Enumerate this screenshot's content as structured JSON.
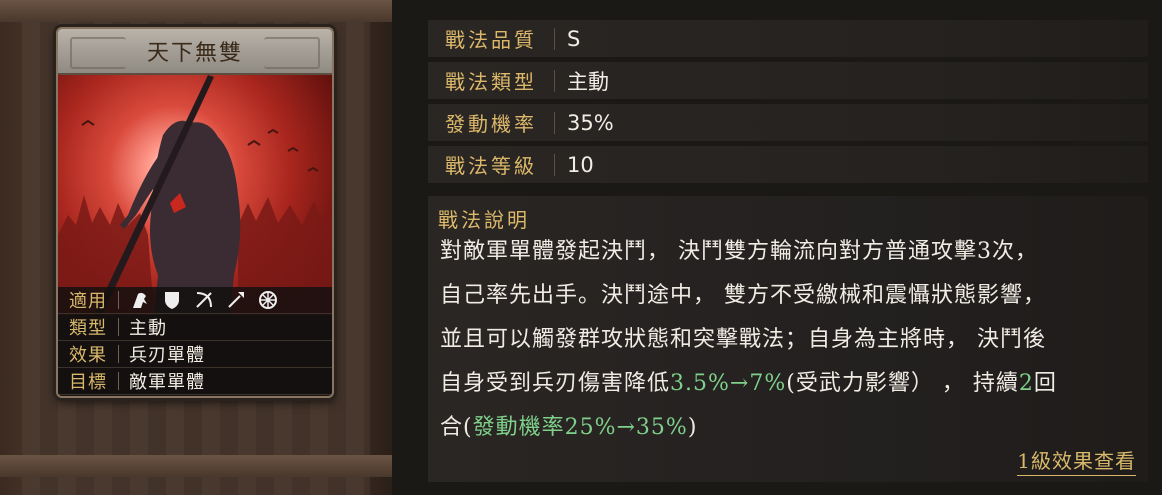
{
  "card": {
    "title": "天下無雙",
    "attributes": [
      {
        "label": "適用",
        "value": "",
        "icons": [
          "cavalry-icon",
          "shield-icon",
          "bow-icon",
          "spear-icon",
          "wheel-icon"
        ]
      },
      {
        "label": "類型",
        "value": "主動"
      },
      {
        "label": "效果",
        "value": "兵刃單體"
      },
      {
        "label": "目標",
        "value": "敵軍單體"
      }
    ]
  },
  "details": {
    "quality_label": "戰法品質",
    "quality_value": "S",
    "type_label": "戰法類型",
    "type_value": "主動",
    "rate_label": "發動機率",
    "rate_value": "35%",
    "level_label": "戰法等級",
    "level_value": "10"
  },
  "description": {
    "title": "戰法說明",
    "line1": "對敵軍單體發起決鬥， 決鬥雙方輪流向對方普通攻擊3次，",
    "line2": "自己率先出手。決鬥途中， 雙方不受繳械和震懾狀態影響，",
    "line3": "並且可以觸發群攻狀態和突擊戰法；自身為主將時， 決鬥後",
    "line4_a": "自身受到兵刃傷害降低",
    "line4_b": "3.5%→7%",
    "line4_c": "(受武力影響） ， 持續",
    "line4_d": "2",
    "line4_e": "回",
    "line5_a": "合(",
    "line5_b": "發動機率25%→35%",
    "line5_c": ")"
  },
  "link": {
    "more": "1級效果查看"
  },
  "colors": {
    "gold": "#dcb86a",
    "green": "#7fd08a",
    "text": "#f0ebe3"
  }
}
